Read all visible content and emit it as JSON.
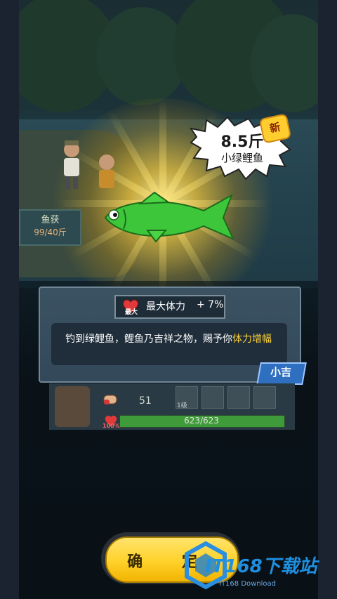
{
  "catch_popup": {
    "weight": "8.5斤",
    "fish_name": "小绿鲤鱼",
    "new_badge": "新",
    "buff_small_label": "最大",
    "buff_name": "最大体力",
    "buff_value": "+ 7%",
    "description_plain": "钓到绿鲤鱼，鲤鱼乃吉祥之物，赐予你",
    "description_highlight": "体力增幅",
    "luck_label": "小吉"
  },
  "hud": {
    "catch_title": "鱼获",
    "catch_count": "99/40斤"
  },
  "player_stats": {
    "attack": "51",
    "weapon_level": "1级",
    "hp_percent_label": "100%",
    "hp_text": "623/623",
    "hp_fraction": 1.0
  },
  "confirm_button": {
    "label": "确 定"
  },
  "watermark": {
    "text": "IT168下载站",
    "sub": "IT168 Download"
  },
  "colors": {
    "fish_green": "#3ec63a",
    "gold_glow": "#f5c83c",
    "panel_bg": "#3b5262",
    "highlight_text": "#ffd23a",
    "button_yellow": "#ffd12a",
    "hp_green": "#3f9a3a"
  }
}
